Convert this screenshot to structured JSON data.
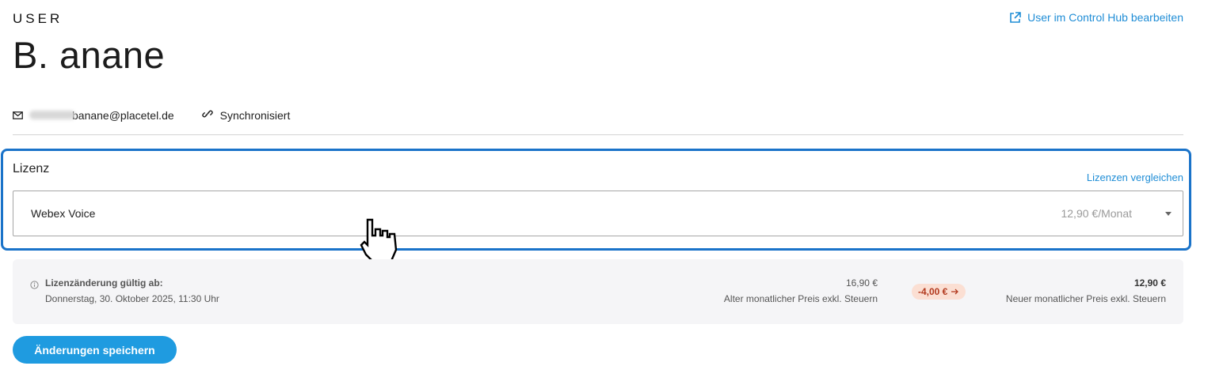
{
  "header": {
    "section_label": "USER",
    "user_name": "B. anane",
    "edit_link_label": "User im Control Hub bearbeiten"
  },
  "meta": {
    "email_visible_part": "banane@placetel.de",
    "sync_label": "Synchronisiert"
  },
  "license": {
    "title": "Lizenz",
    "compare_link": "Lizenzen vergleichen",
    "selected_value": "Webex Voice",
    "selected_price": "12,90 €/Monat"
  },
  "change_info": {
    "heading": "Lizenzänderung gültig ab:",
    "date": "Donnerstag, 30. Oktober 2025, 11:30 Uhr",
    "old_price": "16,90 €",
    "old_caption": "Alter monatlicher Preis exkl. Steuern",
    "difference": "-4,00 €",
    "new_price": "12,90 €",
    "new_caption": "Neuer monatlicher Preis exkl. Steuern"
  },
  "actions": {
    "save_label": "Änderungen speichern"
  },
  "colors": {
    "accent": "#1f8dd6",
    "focus_border": "#1a73c9",
    "button": "#1f9be0",
    "badge_bg": "#fbdfd3",
    "badge_text": "#b2391e"
  },
  "icons": [
    "external-link-icon",
    "mail-icon",
    "link-icon",
    "info-icon",
    "arrow-right-icon",
    "chevron-down-icon",
    "hand-pointer-icon"
  ]
}
